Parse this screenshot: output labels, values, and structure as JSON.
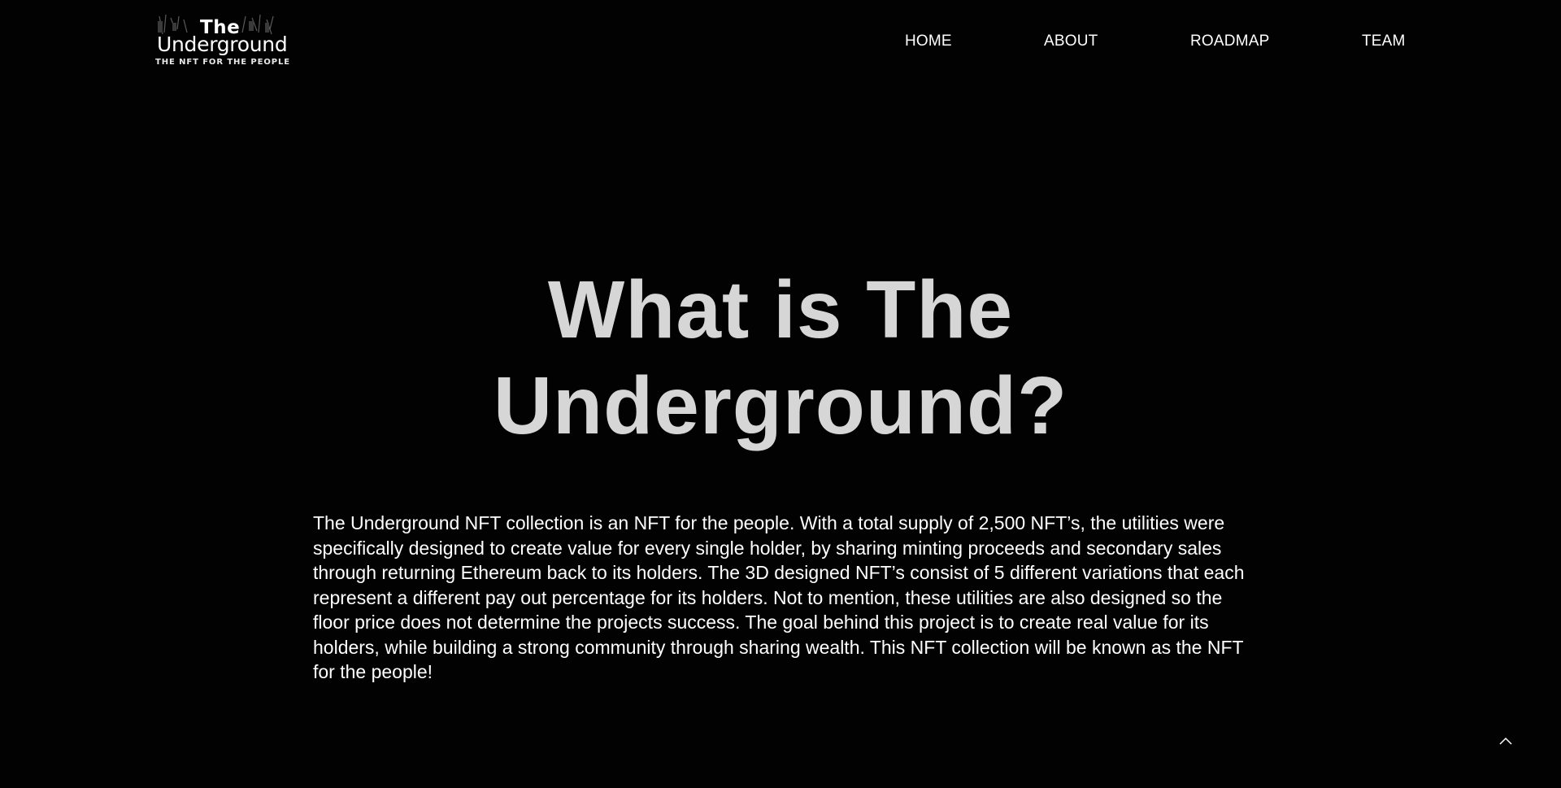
{
  "brand": {
    "logo_the": "The",
    "logo_name": "Underground",
    "tagline": "THE NFT FOR THE PEOPLE"
  },
  "nav": {
    "items": [
      {
        "label": "HOME"
      },
      {
        "label": "ABOUT"
      },
      {
        "label": "ROADMAP"
      },
      {
        "label": "TEAM"
      }
    ]
  },
  "main": {
    "title_line1": "What is The",
    "title_line2": "Underground?",
    "description": "The Underground NFT collection is an NFT for the people. With a total supply of 2,500 NFT’s, the utilities were specifically designed to create value for every single holder, by sharing minting proceeds and secondary sales through returning Ethereum back to its holders. The 3D designed NFT’s consist of 5 different variations that each represent a different pay out percentage for its holders. Not to mention, these utilities are also designed so the floor price does not determine the projects success. The goal behind this project is to create real value for its holders, while building a strong community through sharing wealth. This NFT collection will be known as the NFT for the people!"
  },
  "scroll_top": {
    "icon": "chevron-up-icon"
  },
  "colors": {
    "background": "#020202",
    "title": "#d6d6d6",
    "text": "#ffffff"
  }
}
